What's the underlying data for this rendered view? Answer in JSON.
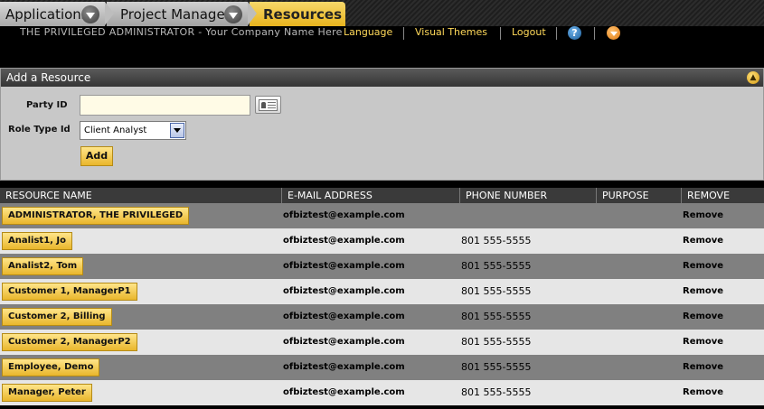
{
  "appbar": {
    "tabs": [
      {
        "label": "Applications"
      },
      {
        "label": "Project Manager"
      },
      {
        "label": "Resources"
      }
    ]
  },
  "header": {
    "company": "THE PRIVILEGED ADMINISTRATOR - Your Company Name Here",
    "links": [
      "Language",
      "Visual Themes",
      "Logout"
    ],
    "help_icon_text": "?",
    "help_icon": "help-icon",
    "menu_icon": "dropdown-icon"
  },
  "panel": {
    "title": "Add a Resource",
    "party_id_label": "Party ID",
    "party_id_value": "",
    "role_type_label": "Role Type Id",
    "role_type_value": "Client Analyst",
    "add_label": "Add",
    "collapse_icon": "collapse-up-icon"
  },
  "table": {
    "columns": [
      "RESOURCE NAME",
      "E-MAIL ADDRESS",
      "PHONE NUMBER",
      "PURPOSE",
      "REMOVE"
    ],
    "rows": [
      {
        "name": "ADMINISTRATOR, THE PRIVILEGED",
        "email": "ofbiztest@example.com",
        "phone": "",
        "purpose": "",
        "remove": "Remove"
      },
      {
        "name": "Analist1, Jo",
        "email": "ofbiztest@example.com",
        "phone": "801 555-5555",
        "purpose": "",
        "remove": "Remove"
      },
      {
        "name": "Analist2, Tom",
        "email": "ofbiztest@example.com",
        "phone": "801 555-5555",
        "purpose": "",
        "remove": "Remove"
      },
      {
        "name": "Customer 1, ManagerP1",
        "email": "ofbiztest@example.com",
        "phone": "801 555-5555",
        "purpose": "",
        "remove": "Remove"
      },
      {
        "name": "Customer 2, Billing",
        "email": "ofbiztest@example.com",
        "phone": "801 555-5555",
        "purpose": "",
        "remove": "Remove"
      },
      {
        "name": "Customer 2, ManagerP2",
        "email": "ofbiztest@example.com",
        "phone": "801 555-5555",
        "purpose": "",
        "remove": "Remove"
      },
      {
        "name": "Employee, Demo",
        "email": "ofbiztest@example.com",
        "phone": "801 555-5555",
        "purpose": "",
        "remove": "Remove"
      },
      {
        "name": "Manager, Peter",
        "email": "ofbiztest@example.com",
        "phone": "801 555-5555",
        "purpose": "",
        "remove": "Remove"
      }
    ]
  },
  "colors": {
    "accent": "#f0c233",
    "header_bg": "#000000",
    "row_dark": "#808080",
    "row_light": "#e6e6e6"
  }
}
